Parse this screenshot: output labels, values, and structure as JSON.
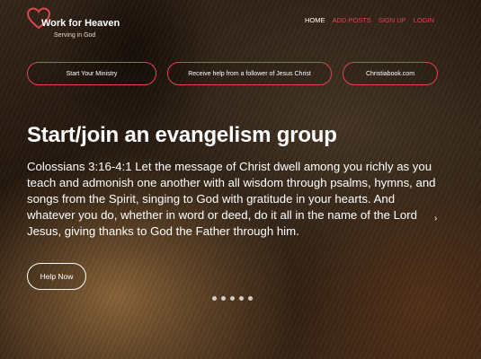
{
  "brand": {
    "title": "Work for Heaven",
    "subtitle": "Serving in God",
    "accent": "#e04552"
  },
  "nav": {
    "items": [
      "HOME",
      "ADD POSTS",
      "SIGN UP",
      "LOGIN"
    ],
    "active": "HOME"
  },
  "quick_links": [
    "Start Your Ministry",
    "Receive help from a follower of Jesus Christ",
    "Christiabook.com"
  ],
  "hero": {
    "headline": "Start/join an evangelism group",
    "verse": "Colossians 3:16-4:1 Let the message of Christ dwell among you richly as you teach and admonish one another with all wisdom through psalms, hymns, and songs from the Spirit, singing to God with gratitude in your hearts. And whatever you do, whether in word or deed, do it all in the name of the Lord Jesus, giving thanks to God the Father through him.",
    "cta": "Help Now"
  },
  "carousel": {
    "slide_count": 5,
    "next_icon": "chevron-right-icon"
  }
}
